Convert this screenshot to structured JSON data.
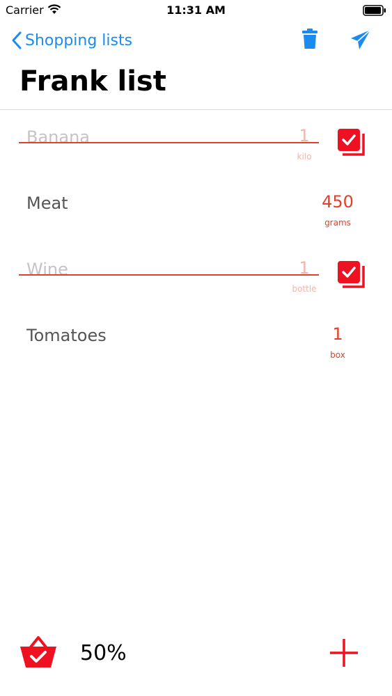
{
  "status_bar": {
    "carrier": "Carrier",
    "time": "11:31 AM"
  },
  "nav": {
    "back_label": "Shopping lists"
  },
  "list": {
    "title": "Frank list",
    "items": [
      {
        "name": "Banana",
        "quantity": "1",
        "unit": "kilo",
        "checked": true
      },
      {
        "name": "Meat",
        "quantity": "450",
        "unit": "grams",
        "checked": false
      },
      {
        "name": "Wine",
        "quantity": "1",
        "unit": "bottle",
        "checked": true
      },
      {
        "name": "Tomatoes",
        "quantity": "1",
        "unit": "box",
        "checked": false
      }
    ]
  },
  "footer": {
    "progress": "50%"
  },
  "colors": {
    "accent_red": "#e2402a",
    "check_red": "#ee1122",
    "link_blue": "#1a8cf0"
  },
  "icons": [
    "wifi-icon",
    "battery-icon",
    "chevron-left-icon",
    "trash-icon",
    "send-icon",
    "checkbox-checked-icon",
    "basket-check-icon",
    "plus-icon"
  ]
}
